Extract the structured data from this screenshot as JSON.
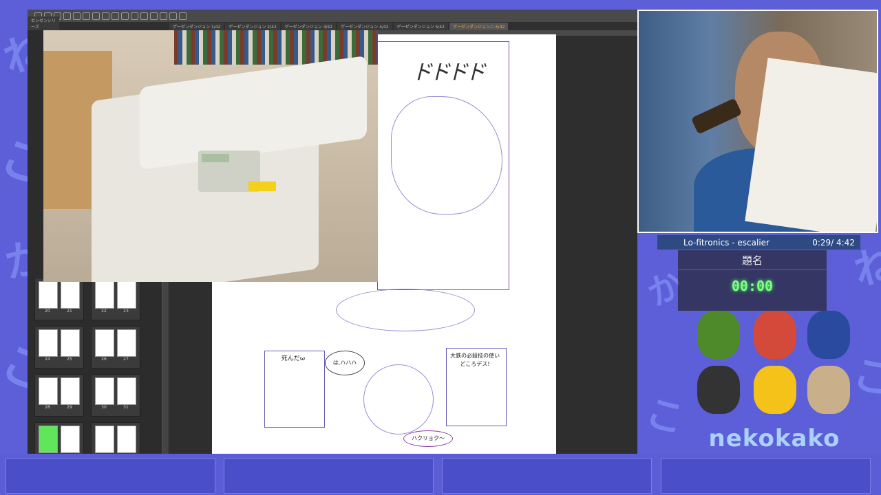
{
  "toolbar": {
    "icon_names": [
      "new-file-icon",
      "open-icon",
      "save-icon",
      "print-icon",
      "undo-icon",
      "redo-icon",
      "copy-icon",
      "paste-icon",
      "transform-icon",
      "cut-icon",
      "fill-icon",
      "select-icon",
      "lasso-icon",
      "ruler-icon",
      "pen-icon",
      "vector-icon"
    ]
  },
  "tabs": {
    "left_tab": "ゼンゼンシリーズ",
    "items": [
      {
        "label": "ゲーゼンダンジョン 1/42"
      },
      {
        "label": "ゲーゼンダンジョン 2/42"
      },
      {
        "label": "ゲーゼンダンジョン 3/42"
      },
      {
        "label": "ゲーゼンダンジョン 4/42"
      },
      {
        "label": "ゲーゼンダンジョン 5/42"
      },
      {
        "label": "ゲーゼンダンジョンニ 6/42",
        "active": true
      }
    ]
  },
  "pages": {
    "rows": [
      [
        {
          "n": "20"
        },
        {
          "n": "21"
        },
        {
          "n": "22"
        },
        {
          "n": "23"
        }
      ],
      [
        {
          "n": "24"
        },
        {
          "n": "25"
        },
        {
          "n": "26"
        },
        {
          "n": "27"
        }
      ],
      [
        {
          "n": "28"
        },
        {
          "n": "29"
        },
        {
          "n": "30"
        },
        {
          "n": "31"
        }
      ],
      [
        {
          "n": "",
          "green": true
        },
        {
          "n": ""
        },
        {
          "n": ""
        },
        {
          "n": ""
        }
      ]
    ]
  },
  "manga": {
    "sfx": "ドドドド",
    "bubble_1": "死んだω",
    "bubble_2": "は,ハハハ",
    "bubble_3": "大鉄の必殺技の使いどころデス!",
    "bubble_4": "ハクリョク〜"
  },
  "music": {
    "track": "Lo-fitronics - escalier",
    "time": "0:29/ 4:42"
  },
  "timer": {
    "title": "題名",
    "value": "00:00"
  },
  "logo": {
    "text": "nekokako"
  },
  "colors": {
    "accent": "#f4a340",
    "timer_green": "#7dff86",
    "background": "#5c5fd8",
    "music_bar": "#2f4a83"
  }
}
